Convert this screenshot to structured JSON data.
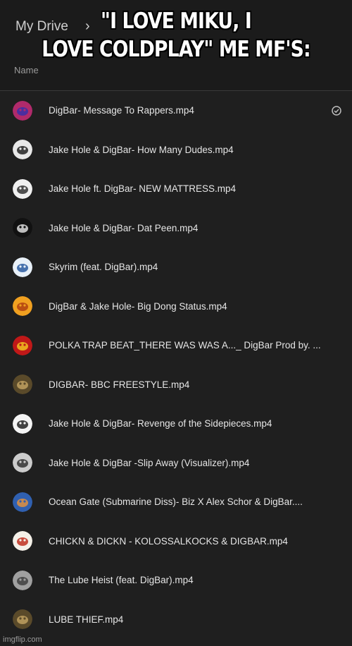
{
  "header": {
    "breadcrumb_root": "My Drive",
    "column_name": "Name"
  },
  "meme": {
    "caption_line1": "\"I LOVE MIKU, I",
    "caption_line2": "LOVE COLDPLAY\" ME MF'S:"
  },
  "files": [
    {
      "name": "DigBar- Message To Rappers.mp4",
      "thumb_color": "#b02a6b",
      "thumb_accent": "#3a2fa8"
    },
    {
      "name": "Jake Hole & DigBar- How Many Dudes.mp4",
      "thumb_color": "#e8e8e8",
      "thumb_accent": "#222222"
    },
    {
      "name": "Jake Hole ft. DigBar- NEW MATTRESS.mp4",
      "thumb_color": "#f0f0f0",
      "thumb_accent": "#333333"
    },
    {
      "name": "Jake Hole & DigBar- Dat Peen.mp4",
      "thumb_color": "#111111",
      "thumb_accent": "#dddddd"
    },
    {
      "name": "Skyrim (feat. DigBar).mp4",
      "thumb_color": "#e8f0f8",
      "thumb_accent": "#2a5aa0"
    },
    {
      "name": "DigBar & Jake Hole- Big Dong Status.mp4",
      "thumb_color": "#f0a020",
      "thumb_accent": "#b04010"
    },
    {
      "name": "POLKA TRAP BEAT_THERE WAS WAS A..._ DigBar Prod by. ...",
      "thumb_color": "#c01818",
      "thumb_accent": "#f0c020"
    },
    {
      "name": "DIGBAR- BBC FREESTYLE.mp4",
      "thumb_color": "#5a4a2a",
      "thumb_accent": "#c0a060"
    },
    {
      "name": "Jake Hole & DigBar- Revenge of the Sidepieces.mp4",
      "thumb_color": "#f4f4f4",
      "thumb_accent": "#222222"
    },
    {
      "name": "Jake Hole & DigBar -Slip Away (Visualizer).mp4",
      "thumb_color": "#cccccc",
      "thumb_accent": "#333333"
    },
    {
      "name": "Ocean Gate (Submarine Diss)- Biz X Alex Schor & DigBar....",
      "thumb_color": "#3060b0",
      "thumb_accent": "#e09040"
    },
    {
      "name": "CHICKN & DICKN - KOLOSSALKOCKS & DIGBAR.mp4",
      "thumb_color": "#f4f0e8",
      "thumb_accent": "#c03020"
    },
    {
      "name": "The Lube Heist (feat. DigBar).mp4",
      "thumb_color": "#a0a0a0",
      "thumb_accent": "#404040"
    },
    {
      "name": "LUBE THIEF.mp4",
      "thumb_color": "#5a4a2a",
      "thumb_accent": "#c0a060"
    }
  ],
  "status_icon": "check-circle-icon",
  "watermark": "imgflip.com"
}
